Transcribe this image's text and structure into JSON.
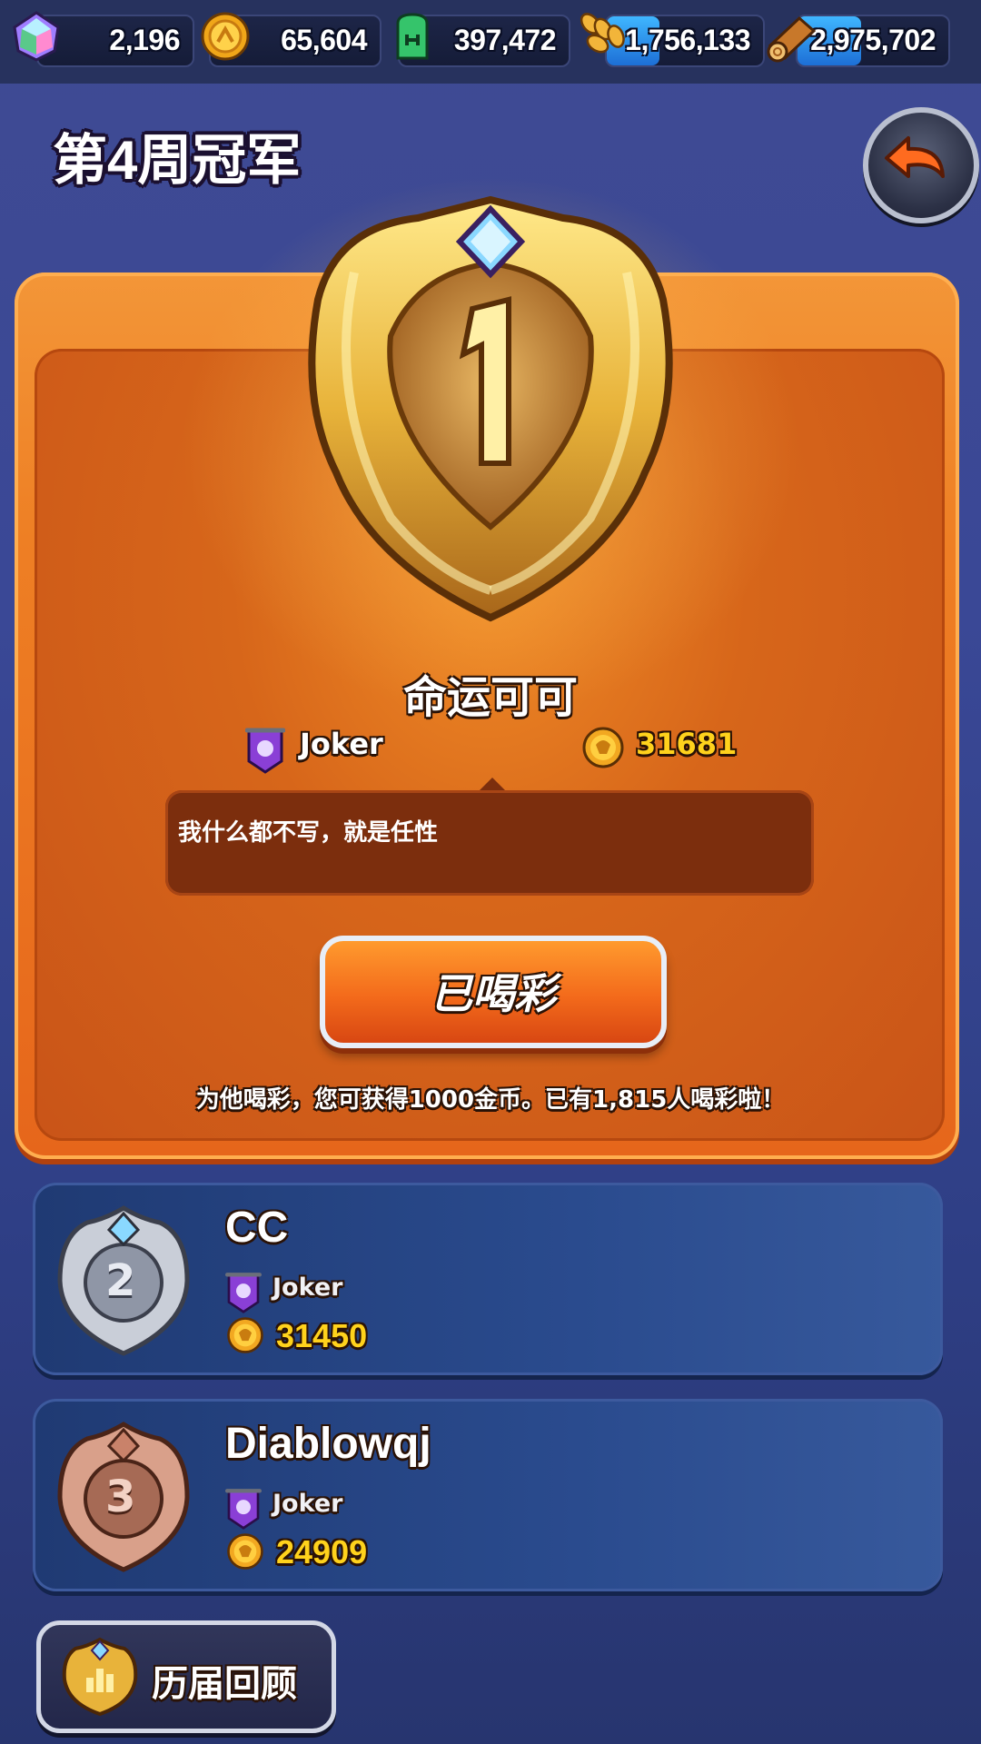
{
  "resources": [
    {
      "icon": "crystal-icon",
      "value": "2,196"
    },
    {
      "icon": "coin-icon",
      "value": "65,604"
    },
    {
      "icon": "green-tome-icon",
      "value": "397,472"
    },
    {
      "icon": "wheat-icon",
      "value": "1,756,133"
    },
    {
      "icon": "wood-log-icon",
      "value": "2,975,702"
    }
  ],
  "page": {
    "title": "第4周冠军",
    "back_icon": "back-arrow-icon"
  },
  "champion": {
    "rank": "1",
    "name": "命运可可",
    "guild": "Joker",
    "score": "31681",
    "message": "我什么都不写，就是任性",
    "cheer_button": "已喝彩",
    "cheer_note": "为他喝彩，您可获得1000金币。已有1,815人喝彩啦！"
  },
  "runners_up": [
    {
      "rank": "2",
      "name": "CC",
      "guild": "Joker",
      "score": "31450"
    },
    {
      "rank": "3",
      "name": "Diablowqj",
      "guild": "Joker",
      "score": "24909"
    }
  ],
  "history_button": "历届回顾",
  "colors": {
    "accent_orange": "#ee7f24",
    "gold_text": "#ffd21c",
    "background": "#3a4896"
  }
}
